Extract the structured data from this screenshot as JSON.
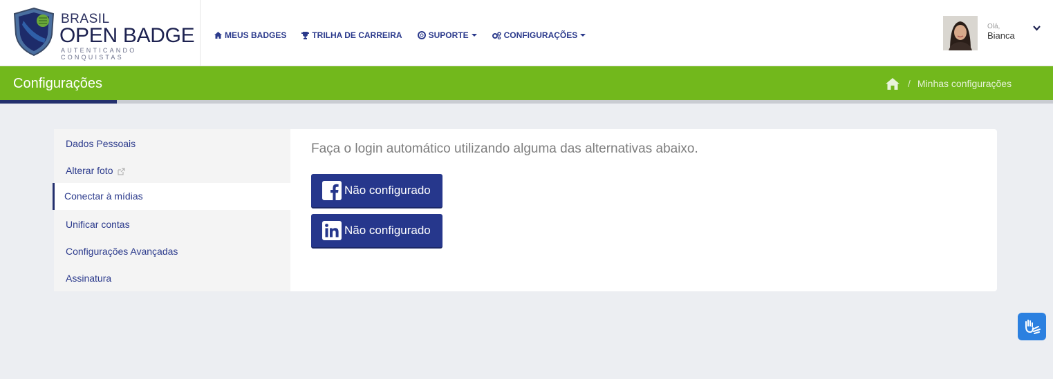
{
  "brand": {
    "line1": "BRASIL",
    "line2": "OPEN BADGE",
    "tagline": "AUTENTICANDO CONQUISTAS"
  },
  "nav": {
    "items": [
      {
        "label": "MEUS BADGES",
        "icon": "home-icon",
        "dropdown": false
      },
      {
        "label": "TRILHA DE CARREIRA",
        "icon": "trophy-icon",
        "dropdown": false
      },
      {
        "label": "SUPORTE",
        "icon": "life-ring-icon",
        "dropdown": true
      },
      {
        "label": "CONFIGURAÇÕES",
        "icon": "cogs-icon",
        "dropdown": true
      }
    ]
  },
  "user": {
    "greeting": "Olá,",
    "name": "Bianca"
  },
  "page": {
    "title": "Configurações",
    "breadcrumb_separator": "/",
    "breadcrumb_current": "Minhas configurações"
  },
  "sidebar": {
    "items": [
      {
        "label": "Dados Pessoais",
        "active": false
      },
      {
        "label": "Alterar foto",
        "active": false,
        "external": true
      },
      {
        "label": "Conectar à mídias",
        "active": true
      },
      {
        "label": "Unificar contas",
        "active": false
      },
      {
        "label": "Configurações Avançadas",
        "active": false
      },
      {
        "label": "Assinatura",
        "active": false
      }
    ]
  },
  "main": {
    "heading": "Faça o login automático utilizando alguma das alternativas abaixo.",
    "buttons": [
      {
        "network": "facebook",
        "icon": "facebook-icon",
        "label": "Não configurado"
      },
      {
        "network": "linkedin",
        "icon": "linkedin-icon",
        "label": "Não configurado"
      }
    ]
  },
  "colors": {
    "accent_green": "#72b81c",
    "brand_navy": "#26378c",
    "background": "#eceef2",
    "accessibility_blue": "#2b80e0"
  }
}
